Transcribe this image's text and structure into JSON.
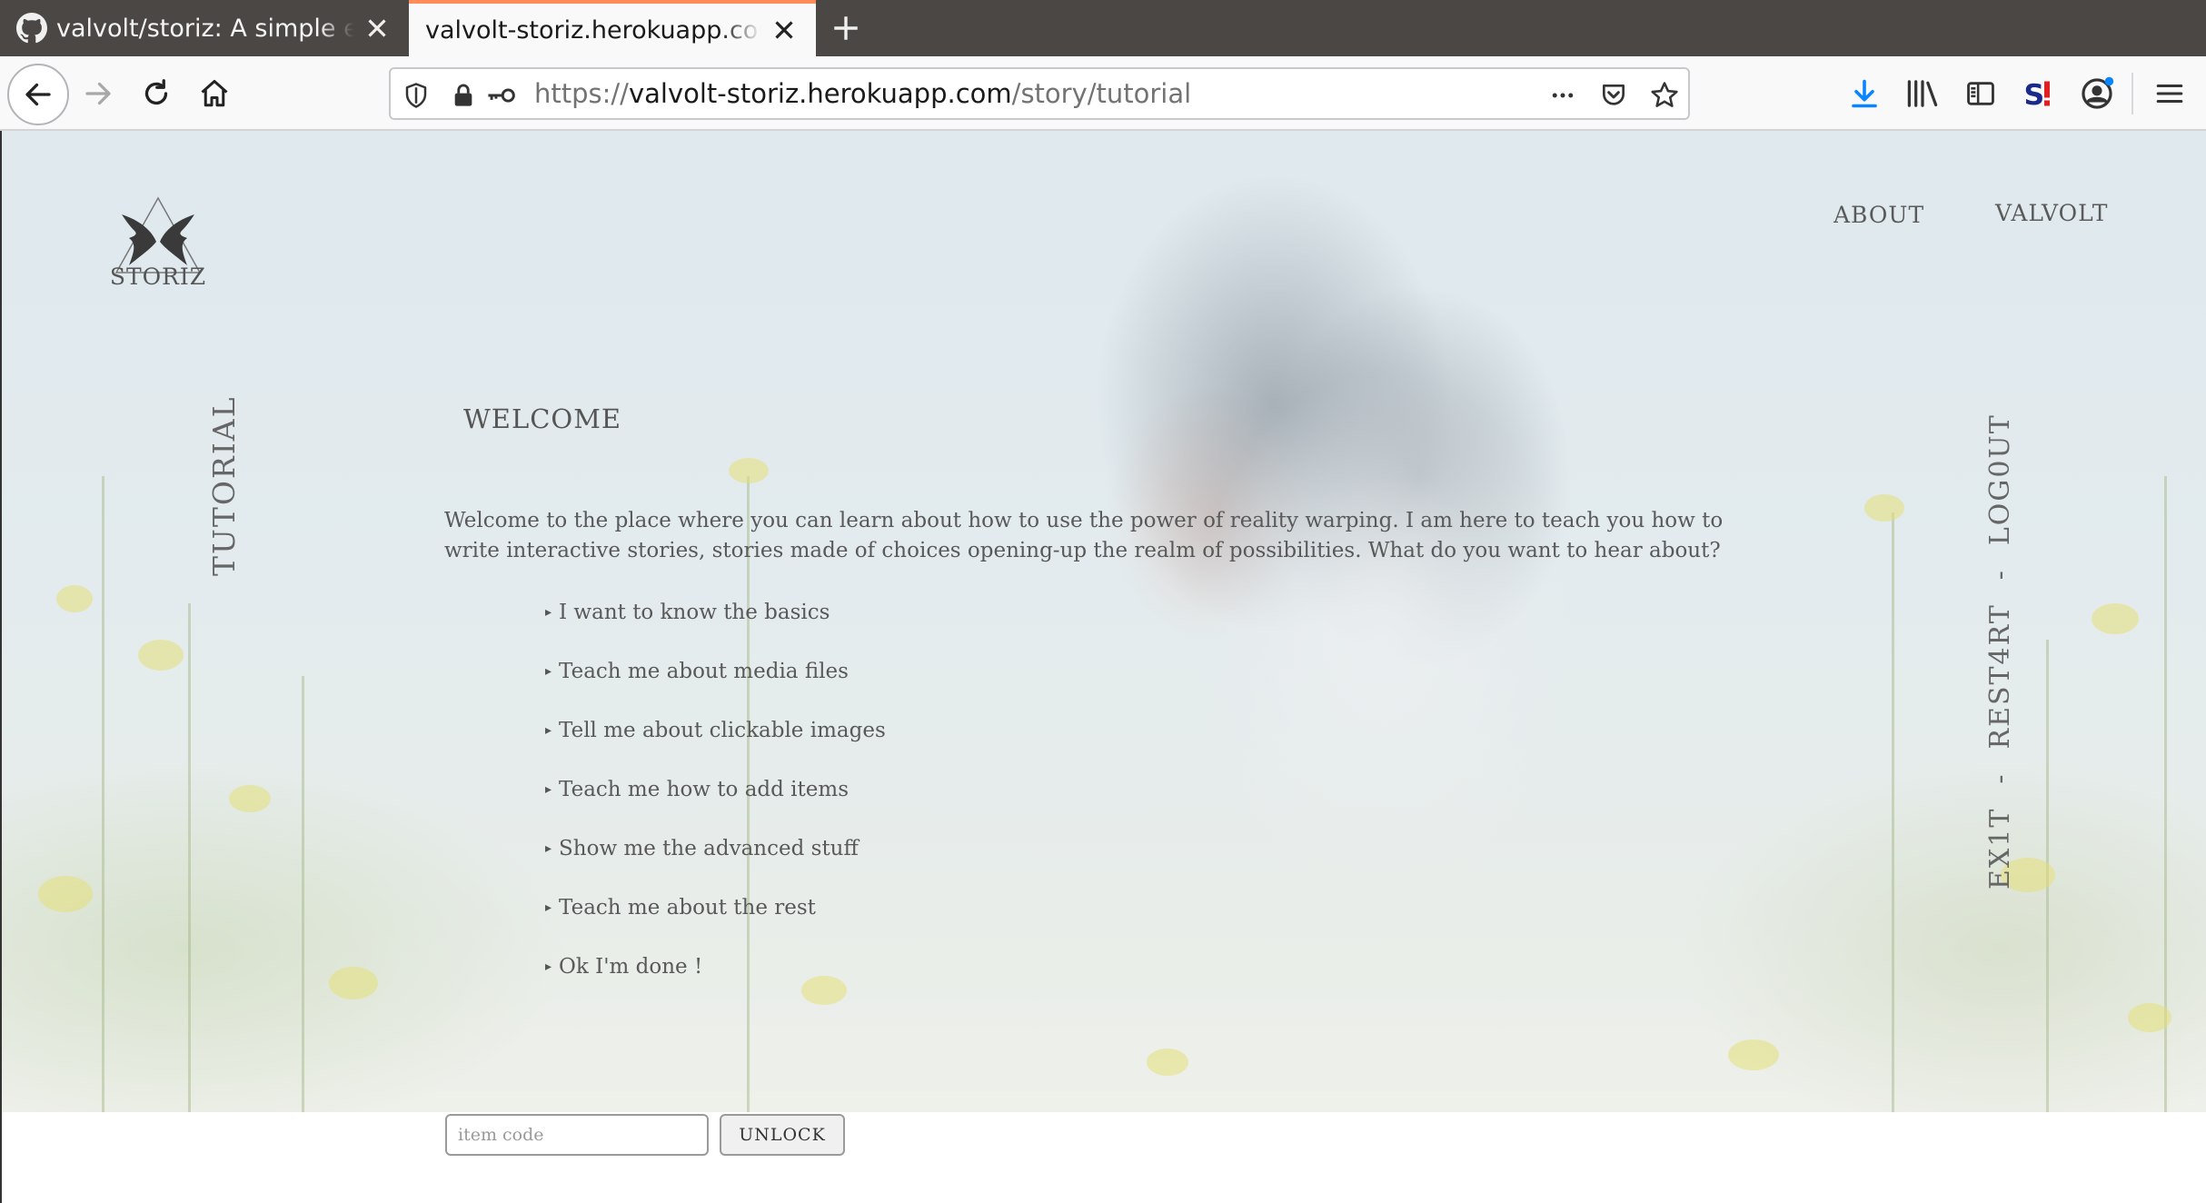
{
  "browser": {
    "tabs": [
      {
        "title": "valvolt/storiz: A simple e",
        "active": false,
        "icon": "github-icon"
      },
      {
        "title": "valvolt-storiz.herokuapp.com",
        "active": true,
        "icon": ""
      }
    ],
    "new_tab_label": "+",
    "url": {
      "scheme": "https://",
      "host": "valvolt-storiz.herokuapp.com",
      "path": "/story/tutorial"
    },
    "active_tab_accent": "#ff8c5a",
    "download_icon_color": "#0a84ff"
  },
  "site": {
    "logo_text": "STORIZ",
    "nav": {
      "about": "ABOUT",
      "valvolt": "VALVOLT"
    },
    "story_name": "TUTORIAL",
    "side_actions": {
      "logout": "LOG0UT",
      "restart": "REST4RT",
      "exit": "EX1T",
      "separator": "-"
    }
  },
  "story": {
    "title": "WELCOME",
    "text": "Welcome to the place where you can learn about how to use the power of reality warping. I am here to teach you how to write interactive stories, stories made of choices opening-up the realm of possibilities. What do you want to hear about?",
    "choice_marker": "▸",
    "choices": [
      "I want to know the basics",
      "Teach me about media files",
      "Tell me about clickable images",
      "Teach me how to add items",
      "Show me the advanced stuff",
      "Teach me about the rest",
      "Ok I'm done !"
    ]
  },
  "unlock": {
    "placeholder": "item code",
    "value": "",
    "button_label": "UNLOCK"
  }
}
